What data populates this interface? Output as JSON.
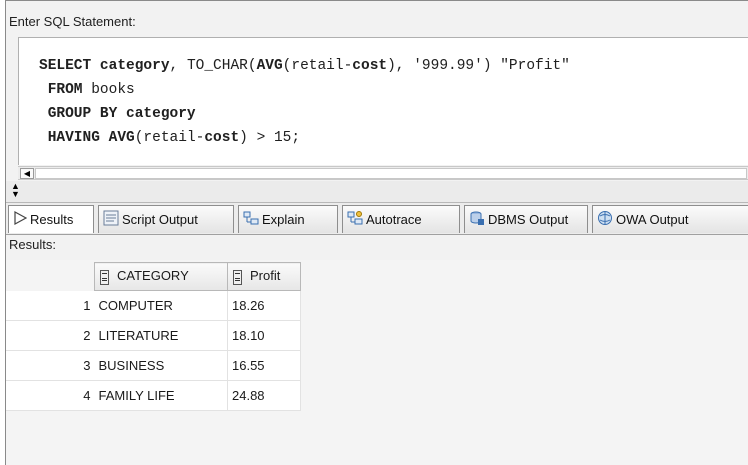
{
  "editor": {
    "label": "Enter SQL Statement:",
    "lines": [
      {
        "kw1": "SELECT ",
        "b1": "category",
        "t1": ", TO_CHAR(",
        "b2": "AVG",
        "t2": "(retail-",
        "b3": "cost",
        "t3": "), '999.99') \"Profit\""
      },
      {
        "kw1": " FROM ",
        "t1": "books"
      },
      {
        "kw1": " GROUP BY ",
        "b1": "category"
      },
      {
        "kw1": " HAVING ",
        "b1": "AVG",
        "t1": "(retail-",
        "b2": "cost",
        "t2": ") > 15;"
      }
    ]
  },
  "tabs": [
    {
      "label": "Results",
      "icon": "play-icon",
      "active": true
    },
    {
      "label": "Script Output",
      "icon": "script-icon"
    },
    {
      "label": "Explain",
      "icon": "explain-icon"
    },
    {
      "label": "Autotrace",
      "icon": "autotrace-icon"
    },
    {
      "label": "DBMS Output",
      "icon": "dbms-icon"
    },
    {
      "label": "OWA Output",
      "icon": "owa-icon"
    }
  ],
  "results": {
    "label": "Results:",
    "columns": [
      "CATEGORY",
      "Profit"
    ],
    "rows": [
      {
        "num": "1",
        "category": "COMPUTER",
        "profit": "18.26"
      },
      {
        "num": "2",
        "category": "LITERATURE",
        "profit": "18.10"
      },
      {
        "num": "3",
        "category": "BUSINESS",
        "profit": "16.55"
      },
      {
        "num": "4",
        "category": "FAMILY LIFE",
        "profit": "24.88"
      }
    ]
  },
  "colors": {
    "accent_blue": "#3a6fb0",
    "grid_bg": "#f4f4f4"
  }
}
